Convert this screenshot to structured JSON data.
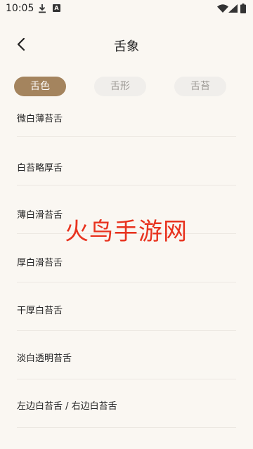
{
  "status_bar": {
    "time": "10:05",
    "download_icon": "download-arrow-icon",
    "a_badge": "A",
    "wifi_icon": "wifi-icon",
    "signal_icon": "cell-signal-icon",
    "battery_icon": "battery-icon"
  },
  "app_bar": {
    "back_icon": "chevron-left-icon",
    "title": "舌象"
  },
  "tabs": [
    {
      "label": "舌色",
      "active": true
    },
    {
      "label": "舌形",
      "active": false
    },
    {
      "label": "舌苔",
      "active": false
    }
  ],
  "list": [
    {
      "label": "微白薄苔舌"
    },
    {
      "label": "白苔略厚舌"
    },
    {
      "label": "薄白滑苔舌"
    },
    {
      "label": "厚白滑苔舌"
    },
    {
      "label": "干厚白苔舌"
    },
    {
      "label": "淡白透明苔舌"
    },
    {
      "label": "左边白苔舌 / 右边白苔舌"
    }
  ],
  "watermark": "火鸟手游网",
  "colors": {
    "background": "#faf7f2",
    "accent": "#a4845e",
    "tab_inactive_bg": "#f0eeeb",
    "tab_inactive_text": "#9b9893",
    "divider": "#ece8e2",
    "watermark": "#e8331f"
  }
}
